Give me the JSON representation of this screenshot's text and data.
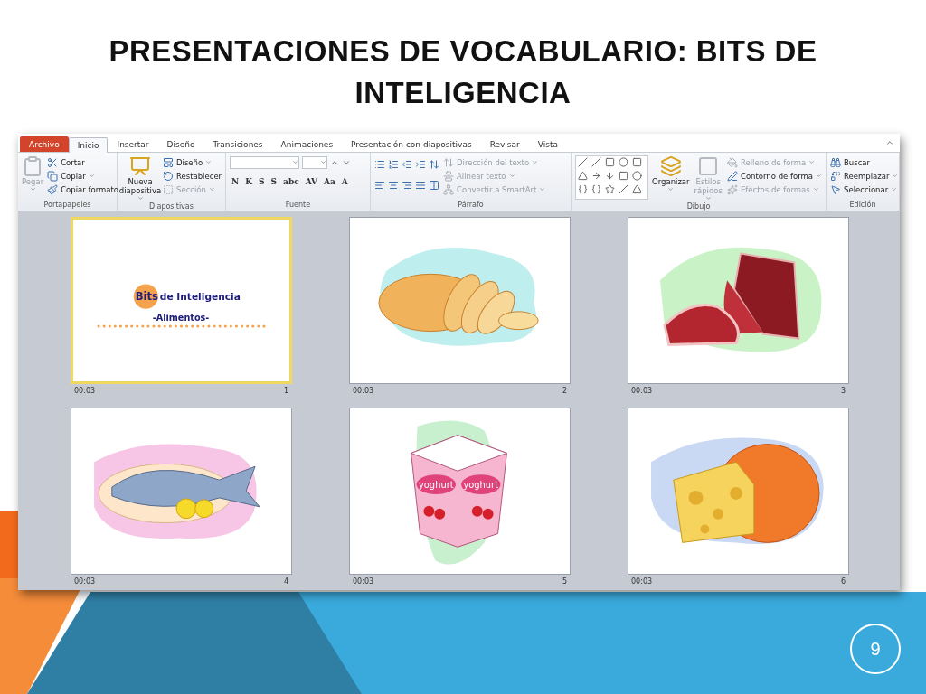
{
  "slide": {
    "title": "PRESENTACIONES DE VOCABULARIO: BITS DE INTELIGENCIA",
    "page_number": "9"
  },
  "ribbon": {
    "tabs": [
      {
        "label": "Archivo",
        "kind": "file",
        "selected": false
      },
      {
        "label": "Inicio",
        "kind": "tab",
        "selected": true
      },
      {
        "label": "Insertar",
        "kind": "tab",
        "selected": false
      },
      {
        "label": "Diseño",
        "kind": "tab",
        "selected": false
      },
      {
        "label": "Transiciones",
        "kind": "tab",
        "selected": false
      },
      {
        "label": "Animaciones",
        "kind": "tab",
        "selected": false
      },
      {
        "label": "Presentación con diapositivas",
        "kind": "tab",
        "selected": false
      },
      {
        "label": "Revisar",
        "kind": "tab",
        "selected": false
      },
      {
        "label": "Vista",
        "kind": "tab",
        "selected": false
      }
    ],
    "groups": [
      {
        "name": "Portapapeles",
        "kind": "text",
        "items": [
          {
            "kind": "large",
            "label": "Pegar",
            "disabled": true,
            "dropdown": true
          },
          {
            "kind": "small",
            "label": "Cortar",
            "disabled": false,
            "dropdown": false
          },
          {
            "kind": "small",
            "label": "Copiar",
            "disabled": false,
            "dropdown": true
          },
          {
            "kind": "small",
            "label": "Copiar formato",
            "disabled": false,
            "dropdown": false
          }
        ]
      },
      {
        "name": "Diapositivas",
        "kind": "text",
        "items": [
          {
            "kind": "large",
            "label": "Nueva diapositiva",
            "disabled": false,
            "dropdown": true
          },
          {
            "kind": "small",
            "label": "Diseño",
            "disabled": false,
            "dropdown": true
          },
          {
            "kind": "small",
            "label": "Restablecer",
            "disabled": false,
            "dropdown": false
          },
          {
            "kind": "small",
            "label": "Sección",
            "disabled": true,
            "dropdown": true
          }
        ]
      },
      {
        "name": "Fuente",
        "kind": "font",
        "glyphs": [
          "N",
          "K",
          "S",
          "S",
          "abc",
          "AV",
          "Aa",
          "A"
        ]
      },
      {
        "name": "Párrafo",
        "kind": "paragraph",
        "items": [
          {
            "kind": "small",
            "label": "Dirección del texto",
            "disabled": true,
            "dropdown": true
          },
          {
            "kind": "small",
            "label": "Alinear texto",
            "disabled": true,
            "dropdown": true
          },
          {
            "kind": "small",
            "label": "Convertir a SmartArt",
            "disabled": true,
            "dropdown": true
          }
        ]
      },
      {
        "name": "Dibujo",
        "kind": "drawing",
        "items": [
          {
            "kind": "large",
            "label": "Organizar",
            "disabled": false,
            "dropdown": true
          },
          {
            "kind": "large",
            "label": "Estilos rápidos",
            "disabled": true,
            "dropdown": true
          },
          {
            "kind": "small",
            "label": "Relleno de forma",
            "disabled": true,
            "dropdown": true
          },
          {
            "kind": "small",
            "label": "Contorno de forma",
            "disabled": false,
            "dropdown": true
          },
          {
            "kind": "small",
            "label": "Efectos de formas",
            "disabled": true,
            "dropdown": true
          }
        ]
      },
      {
        "name": "Edición",
        "kind": "text",
        "items": [
          {
            "kind": "small",
            "label": "Buscar",
            "disabled": false,
            "dropdown": false
          },
          {
            "kind": "small",
            "label": "Reemplazar",
            "disabled": false,
            "dropdown": true
          },
          {
            "kind": "small",
            "label": "Seleccionar",
            "disabled": false,
            "dropdown": true
          }
        ]
      }
    ]
  },
  "slides": [
    {
      "kind": "title",
      "time": "00:03",
      "number": "1",
      "selected": true,
      "badge": "Bits",
      "heading": "de Inteligencia",
      "subtitle": "-Alimentos-"
    },
    {
      "kind": "bread",
      "time": "00:03",
      "number": "2",
      "selected": false
    },
    {
      "kind": "meat",
      "time": "00:03",
      "number": "3",
      "selected": false
    },
    {
      "kind": "fish",
      "time": "00:03",
      "number": "4",
      "selected": false
    },
    {
      "kind": "yoghurt",
      "time": "00:03",
      "number": "5",
      "selected": false,
      "labels": [
        "yoghurt",
        "yoghurt"
      ]
    },
    {
      "kind": "cheese",
      "time": "00:03",
      "number": "6",
      "selected": false
    }
  ]
}
